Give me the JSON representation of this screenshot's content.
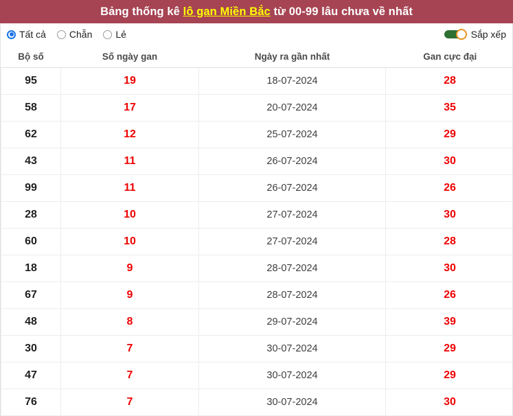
{
  "header": {
    "title_prefix": "Bảng thống kê ",
    "title_link": "lô gan Miền Bắc",
    "title_suffix": " từ 00-99 lâu chưa về nhất",
    "background_color": "#a64453",
    "link_color": "#ffff00"
  },
  "filters": {
    "options": [
      {
        "label": "Tất cả",
        "selected": true
      },
      {
        "label": "Chẵn",
        "selected": false
      },
      {
        "label": "Lẻ",
        "selected": false
      }
    ],
    "sort_toggle": {
      "label": "Sắp xếp",
      "on": true,
      "track_color": "#2e7031",
      "knob_color": "#e8921e"
    }
  },
  "table": {
    "columns": [
      "Bộ số",
      "Số ngày gan",
      "Ngày ra gần nhất",
      "Gan cực đại"
    ],
    "rows": [
      {
        "bo_so": "95",
        "so_ngay_gan": "19",
        "ngay_ra": "18-07-2024",
        "gan_cuc_dai": "28"
      },
      {
        "bo_so": "58",
        "so_ngay_gan": "17",
        "ngay_ra": "20-07-2024",
        "gan_cuc_dai": "35"
      },
      {
        "bo_so": "62",
        "so_ngay_gan": "12",
        "ngay_ra": "25-07-2024",
        "gan_cuc_dai": "29"
      },
      {
        "bo_so": "43",
        "so_ngay_gan": "11",
        "ngay_ra": "26-07-2024",
        "gan_cuc_dai": "30"
      },
      {
        "bo_so": "99",
        "so_ngay_gan": "11",
        "ngay_ra": "26-07-2024",
        "gan_cuc_dai": "26"
      },
      {
        "bo_so": "28",
        "so_ngay_gan": "10",
        "ngay_ra": "27-07-2024",
        "gan_cuc_dai": "30"
      },
      {
        "bo_so": "60",
        "so_ngay_gan": "10",
        "ngay_ra": "27-07-2024",
        "gan_cuc_dai": "28"
      },
      {
        "bo_so": "18",
        "so_ngay_gan": "9",
        "ngay_ra": "28-07-2024",
        "gan_cuc_dai": "30"
      },
      {
        "bo_so": "67",
        "so_ngay_gan": "9",
        "ngay_ra": "28-07-2024",
        "gan_cuc_dai": "26"
      },
      {
        "bo_so": "48",
        "so_ngay_gan": "8",
        "ngay_ra": "29-07-2024",
        "gan_cuc_dai": "39"
      },
      {
        "bo_so": "30",
        "so_ngay_gan": "7",
        "ngay_ra": "30-07-2024",
        "gan_cuc_dai": "29"
      },
      {
        "bo_so": "47",
        "so_ngay_gan": "7",
        "ngay_ra": "30-07-2024",
        "gan_cuc_dai": "29"
      },
      {
        "bo_so": "76",
        "so_ngay_gan": "7",
        "ngay_ra": "30-07-2024",
        "gan_cuc_dai": "30"
      }
    ],
    "value_color": "#ef0000",
    "label_color": "#1f1f1f"
  }
}
